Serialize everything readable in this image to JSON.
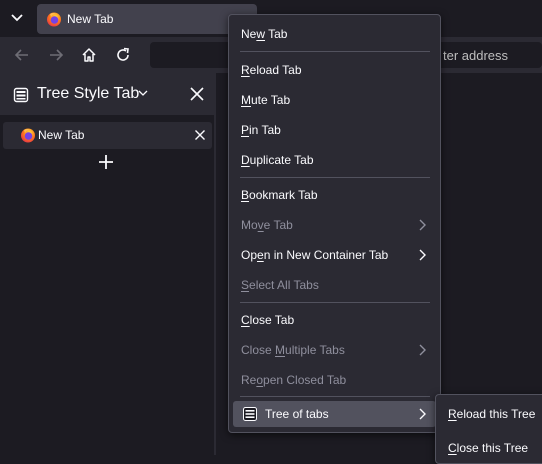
{
  "tabbar": {
    "tab_title": "New Tab"
  },
  "urlbar": {
    "placeholder": "Search or enter address",
    "visible_text": "ter address"
  },
  "sidebar": {
    "title": "Tree Style Tab",
    "tabs": [
      {
        "label": "New Tab"
      }
    ]
  },
  "context_menu": {
    "items": [
      {
        "pre": "Ne",
        "key": "w",
        "post": " Tab",
        "disabled": false
      },
      {
        "pre": "",
        "key": "R",
        "post": "eload Tab",
        "disabled": false
      },
      {
        "pre": "",
        "key": "M",
        "post": "ute Tab",
        "disabled": false
      },
      {
        "pre": "",
        "key": "P",
        "post": "in Tab",
        "disabled": false
      },
      {
        "pre": "",
        "key": "D",
        "post": "uplicate Tab",
        "disabled": false
      },
      {
        "pre": "",
        "key": "B",
        "post": "ookmark Tab",
        "disabled": false
      },
      {
        "pre": "Mo",
        "key": "v",
        "post": "e Tab",
        "disabled": true,
        "submenu": true
      },
      {
        "pre": "Op",
        "key": "e",
        "post": "n in New Container Tab",
        "disabled": false,
        "submenu": true
      },
      {
        "pre": "",
        "key": "S",
        "post": "elect All Tabs",
        "disabled": true
      },
      {
        "pre": "",
        "key": "C",
        "post": "lose Tab",
        "disabled": false
      },
      {
        "pre": "Close ",
        "key": "M",
        "post": "ultiple Tabs",
        "disabled": true,
        "submenu": true
      },
      {
        "pre": "Re",
        "key": "o",
        "post": "pen Closed Tab",
        "disabled": true
      },
      {
        "pre": "",
        "key": "",
        "post": "Tree of tabs",
        "disabled": false,
        "submenu": true,
        "hovered": true
      }
    ]
  },
  "submenu": {
    "items": [
      {
        "pre": "",
        "key": "R",
        "post": "eload this Tree"
      },
      {
        "pre": "",
        "key": "C",
        "post": "lose this Tree"
      }
    ]
  },
  "colors": {
    "toolbar": "#2b2a33",
    "background": "#1c1b22",
    "menu_hover": "#52525e",
    "text": "#fbfbfe",
    "disabled_text": "#8f8f9d"
  },
  "icons": {
    "firefox": "firefox-icon",
    "back": "arrow-left-icon",
    "forward": "arrow-right-icon",
    "home": "home-icon",
    "reload": "reload-icon"
  }
}
